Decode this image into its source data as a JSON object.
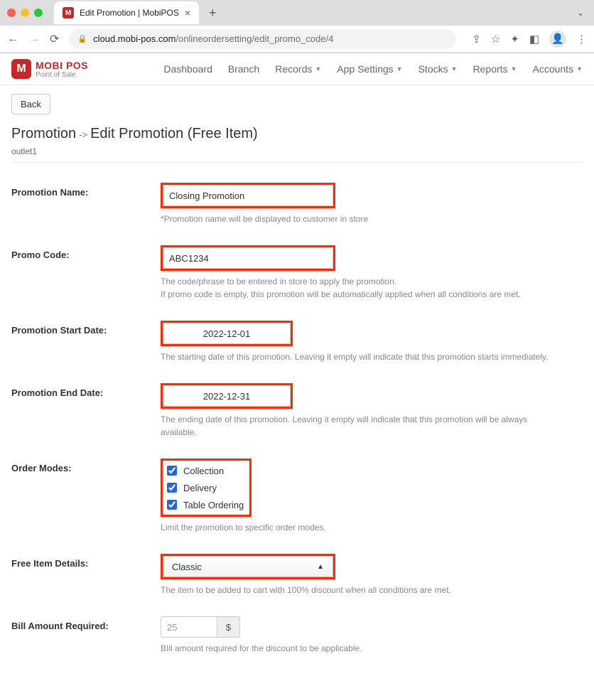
{
  "browser": {
    "tab_title": "Edit Promotion | MobiPOS",
    "url_host": "cloud.mobi-pos.com",
    "url_path": "/onlineordersetting/edit_promo_code/4"
  },
  "logo": {
    "line1": "MOBI POS",
    "line2": "Point of Sale",
    "glyph": "M"
  },
  "nav": {
    "dashboard": "Dashboard",
    "branch": "Branch",
    "records": "Records",
    "app_settings": "App Settings",
    "stocks": "Stocks",
    "reports": "Reports",
    "accounts": "Accounts"
  },
  "page": {
    "back": "Back",
    "crumb_root": "Promotion",
    "crumb_leaf": "Edit Promotion (Free Item)",
    "outlet": "outlet1"
  },
  "form": {
    "name_label": "Promotion Name:",
    "name_value": "Closing Promotion",
    "name_help": "*Promotion name will be displayed to customer in store",
    "code_label": "Promo Code:",
    "code_value": "ABC1234",
    "code_help1": "The code/phrase to be entered in store to apply the promotion.",
    "code_help2": "If promo code is empty, this promotion will be automatically applied when all conditions are met.",
    "start_label": "Promotion Start Date:",
    "start_value": "2022-12-01",
    "start_help": "The starting date of this promotion. Leaving it empty will indicate that this promotion starts immediately.",
    "end_label": "Promotion End Date:",
    "end_value": "2022-12-31",
    "end_help": "The ending date of this promotion. Leaving it empty will indicate that this promotion will be always available.",
    "order_label": "Order Modes:",
    "order_opt1": "Collection",
    "order_opt2": "Delivery",
    "order_opt3": "Table Ordering",
    "order_help": "Limit the promotion to specific order modes.",
    "free_label": "Free Item Details:",
    "free_value": "Classic",
    "free_help": "The item to be added to cart with 100% discount when all conditions are met.",
    "bill_label": "Bill Amount Required:",
    "bill_placeholder": "25",
    "bill_currency": "$",
    "bill_help": "BIll amount required for the discount to be applicable."
  }
}
